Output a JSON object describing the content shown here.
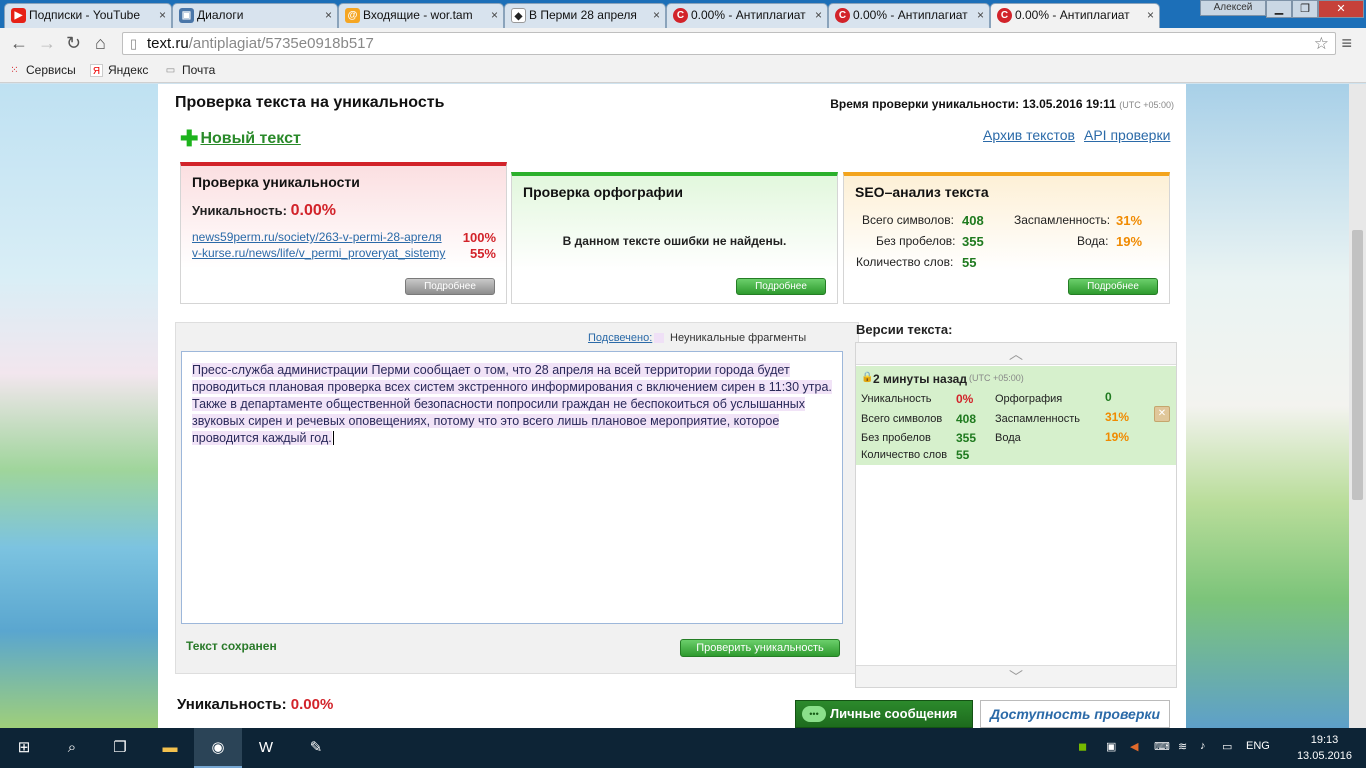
{
  "browser": {
    "tabs": [
      {
        "label": "Подписки - YouTube",
        "favicon": "youtube-icon",
        "color": "#e62117"
      },
      {
        "label": "Диалоги",
        "favicon": "vk-icon",
        "color": "#4a76a8"
      },
      {
        "label": "Входящие - wor.tam",
        "favicon": "mail-icon",
        "color": "#f5a623"
      },
      {
        "label": "В Перми 28 апреля",
        "favicon": "news-icon",
        "color": "#222222"
      },
      {
        "label": "0.00% - Антиплагиат",
        "favicon": "textru-icon",
        "color": "#d2232a"
      },
      {
        "label": "0.00% - Антиплагиат",
        "favicon": "textru-icon",
        "color": "#d2232a"
      },
      {
        "label": "0.00% - Антиплагиат",
        "favicon": "textru-icon",
        "color": "#d2232a"
      }
    ],
    "user": "Алексей",
    "url_host": "text.ru",
    "url_path": "/antiplagiat/5735e0918b517",
    "bookmarks": [
      {
        "label": "Сервисы",
        "icon": "apps-icon"
      },
      {
        "label": "Яндекс",
        "icon": "yandex-icon"
      },
      {
        "label": "Почта",
        "icon": "mail-icon"
      }
    ]
  },
  "page": {
    "title": "Проверка текста на уникальность",
    "check_time_label": "Время проверки уникальности: 13.05.2016 19:11",
    "check_time_utc": "(UTC +05:00)",
    "new_text": "Новый текст",
    "archive_link": "Архив текстов",
    "api_link": "API проверки",
    "details_label": "Подробнее"
  },
  "uniqueness_box": {
    "title": "Проверка уникальности",
    "label": "Уникальность:",
    "value": "0.00%",
    "sources": [
      {
        "url": "news59perm.ru/society/263-v-permi-28-apreля",
        "percent": "100%"
      },
      {
        "url": "v-kurse.ru/news/life/v_permi_proveryat_sistemy",
        "percent": "55%"
      }
    ]
  },
  "spelling_box": {
    "title": "Проверка орфографии",
    "message": "В данном тексте ошибки не найдены."
  },
  "seo_box": {
    "title": "SEO–анализ текста",
    "total_chars_label": "Всего символов:",
    "total_chars": "408",
    "no_spaces_label": "Без пробелов:",
    "no_spaces": "355",
    "words_label": "Количество слов:",
    "words": "55",
    "spam_label": "Заспамленность:",
    "spam": "31%",
    "water_label": "Вода:",
    "water": "19%"
  },
  "editor": {
    "highlight_link": "Подсвечено:",
    "legend_label": "Неуникальные фрагменты",
    "text_lines": [
      "Пресс-служба администрации Перми сообщает о том, что 28 апреля на всей территории города будет",
      "проводиться плановая проверка всех систем экстренного информирования с включением сирен в 11:30 утра.",
      "Также в департаменте общественной безопасности попросили граждан не беспокоиться об услышанных",
      "звуковых сирен и речевых оповещениях, потому что это всего лишь плановое мероприятие, которое",
      "проводится каждый год."
    ],
    "saved_status": "Текст сохранен",
    "check_button": "Проверить уникальность"
  },
  "versions": {
    "title": "Версии текста:",
    "item": {
      "time": "2 минуты назад",
      "utc": "(UTC +05:00)",
      "uniqueness_label": "Уникальность",
      "uniqueness": "0%",
      "spelling_label": "Орфография",
      "spelling": "0",
      "total_chars_label": "Всего символов",
      "total_chars": "408",
      "spam_label": "Заспамленность",
      "spam": "31%",
      "no_spaces_label": "Без пробелов",
      "no_spaces": "355",
      "water_label": "Вода",
      "water": "19%",
      "words_label": "Количество слов",
      "words": "55"
    }
  },
  "bottom": {
    "uniqueness_label": "Уникальность:",
    "uniqueness_value": "0.00%",
    "messages_button": "Личные сообщения",
    "availability_button": "Доступность проверки"
  },
  "taskbar": {
    "lang": "ENG",
    "time": "19:13",
    "date": "13.05.2016"
  }
}
